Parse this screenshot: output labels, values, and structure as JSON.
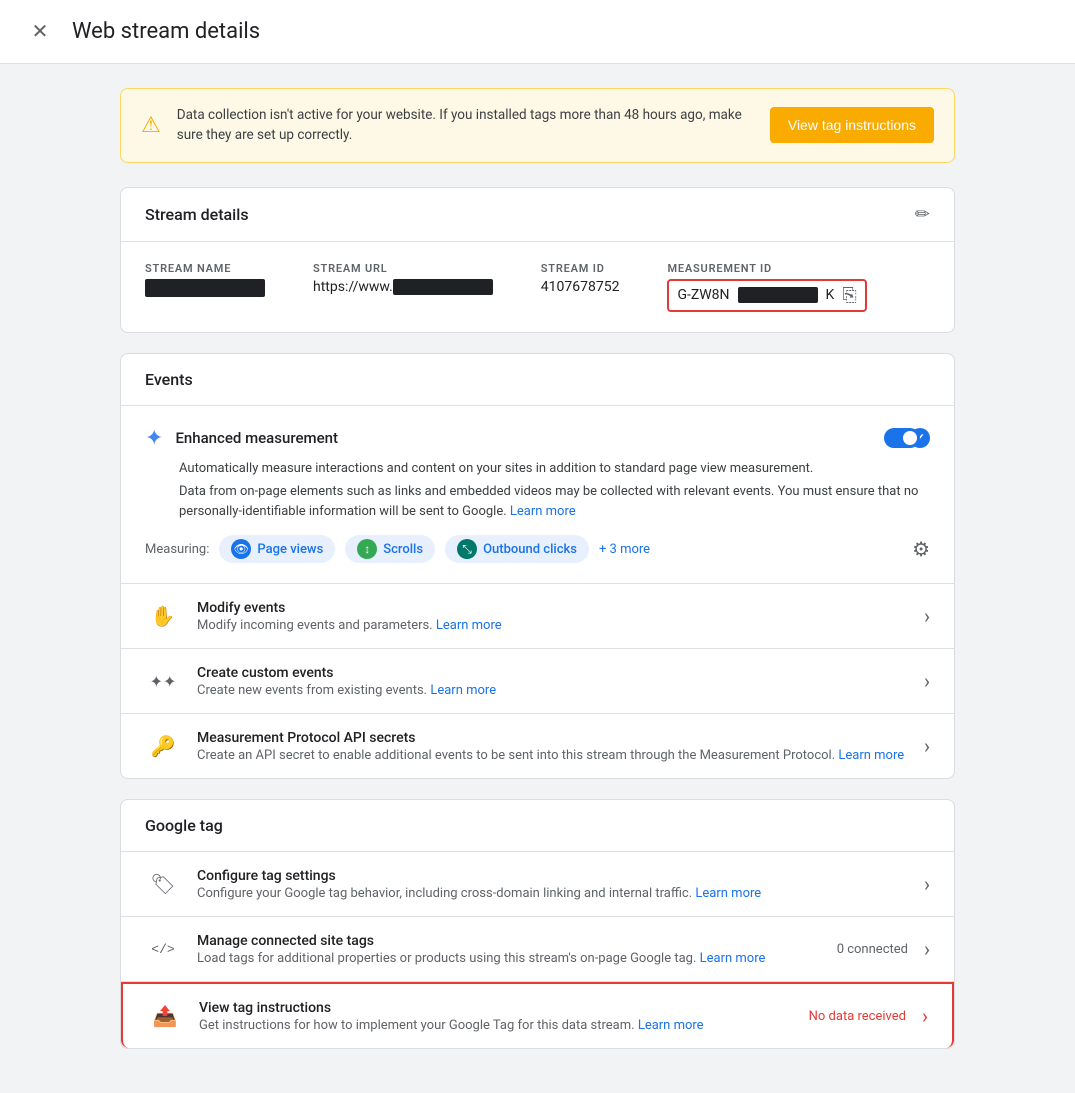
{
  "header": {
    "title": "Web stream details",
    "close_label": "×"
  },
  "alert": {
    "text": "Data collection isn't active for your website. If you installed tags more than 48 hours ago, make sure they are set up correctly.",
    "button_label": "View tag instructions"
  },
  "stream_details": {
    "section_title": "Stream details",
    "fields": [
      {
        "label": "STREAM NAME",
        "value": "",
        "blacked": true
      },
      {
        "label": "STREAM URL",
        "value": "https://www.",
        "blacked_suffix": true
      },
      {
        "label": "STREAM ID",
        "value": "4107678752",
        "blacked": false
      },
      {
        "label": "MEASUREMENT ID",
        "value": "G-ZW8N",
        "blacked_suffix": true
      }
    ]
  },
  "events": {
    "section_title": "Events",
    "enhanced": {
      "title": "Enhanced measurement",
      "desc": "Automatically measure interactions and content on your sites in addition to standard page view measurement.",
      "desc2": "Data from on-page elements such as links and embedded videos may be collected with relevant events. You must ensure that no personally-identifiable information will be sent to Google.",
      "learn_more": "Learn more",
      "enabled": true,
      "measuring_label": "Measuring:",
      "chips": [
        {
          "icon": "👁",
          "label": "Page views",
          "color": "blue"
        },
        {
          "icon": "↕",
          "label": "Scrolls",
          "color": "green"
        },
        {
          "icon": "⤡",
          "label": "Outbound clicks",
          "color": "teal"
        }
      ],
      "more": "+ 3 more"
    },
    "items": [
      {
        "id": "modify-events",
        "title": "Modify events",
        "desc": "Modify incoming events and parameters.",
        "learn_more": "Learn more",
        "icon": "✋"
      },
      {
        "id": "create-custom-events",
        "title": "Create custom events",
        "desc": "Create new events from existing events.",
        "learn_more": "Learn more",
        "icon": "✦"
      },
      {
        "id": "measurement-protocol",
        "title": "Measurement Protocol API secrets",
        "desc": "Create an API secret to enable additional events to be sent into this stream through the Measurement Protocol.",
        "learn_more": "Learn more",
        "icon": "🔑"
      }
    ]
  },
  "google_tag": {
    "section_title": "Google tag",
    "items": [
      {
        "id": "configure-tag",
        "title": "Configure tag settings",
        "desc": "Configure your Google tag behavior, including cross-domain linking and internal traffic.",
        "learn_more": "Learn more",
        "icon": "🏷",
        "status": ""
      },
      {
        "id": "manage-connected",
        "title": "Manage connected site tags",
        "desc": "Load tags for additional properties or products using this stream's on-page Google tag.",
        "learn_more": "Learn more",
        "icon": "<>",
        "status": "0 connected"
      },
      {
        "id": "view-tag-instructions",
        "title": "View tag instructions",
        "desc": "Get instructions for how to implement your Google Tag for this data stream.",
        "learn_more": "Learn more",
        "icon": "⬆",
        "status": "No data received",
        "highlighted": true
      }
    ]
  }
}
